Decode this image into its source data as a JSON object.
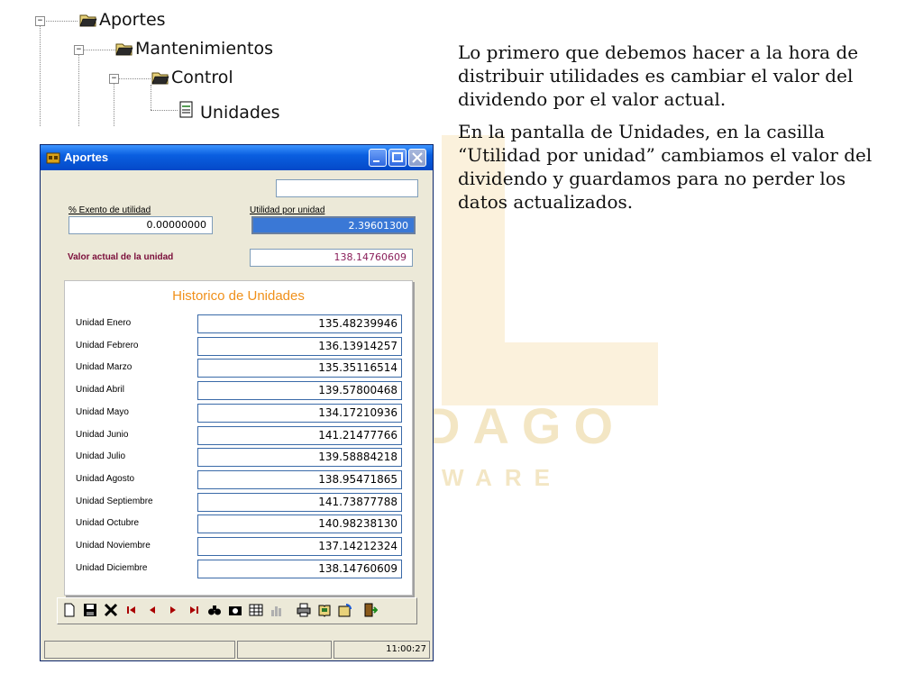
{
  "tree": {
    "nodes": [
      {
        "label": "Aportes",
        "expander": "−"
      },
      {
        "label": "Mantenimientos",
        "expander": "−"
      },
      {
        "label": "Control",
        "expander": "−"
      },
      {
        "label": "Unidades"
      }
    ]
  },
  "description": {
    "paragraph1": "Lo primero que debemos hacer a la hora de distribuir utilidades es cambiar el valor del dividendo por el valor actual.",
    "paragraph2": "En la pantalla de Unidades, en la casilla “Utilidad por unidad” cambiamos el valor del dividendo y guardamos para no perder los datos actualizados."
  },
  "watermark": {
    "line1": "DAGO",
    "line2": "WARE"
  },
  "window": {
    "title": "Aportes",
    "exento_label": "% Exento de utilidad",
    "exento_value": "0.00000000",
    "utilidad_label": "Utilidad por unidad",
    "utilidad_value": "2.39601300",
    "top_field_value": "",
    "valor_actual_label": "Valor actual de la unidad",
    "valor_actual_value": "138.14760609",
    "historico_title": "Historico de Unidades",
    "historico": [
      {
        "label": "Unidad Enero",
        "value": "135.48239946"
      },
      {
        "label": "Unidad Febrero",
        "value": "136.13914257"
      },
      {
        "label": "Unidad Marzo",
        "value": "135.35116514"
      },
      {
        "label": "Unidad Abril",
        "value": "139.57800468"
      },
      {
        "label": "Unidad Mayo",
        "value": "134.17210936"
      },
      {
        "label": "Unidad Junio",
        "value": "141.21477766"
      },
      {
        "label": "Unidad Julio",
        "value": "139.58884218"
      },
      {
        "label": "Unidad Agosto",
        "value": "138.95471865"
      },
      {
        "label": "Unidad Septiembre",
        "value": "141.73877788"
      },
      {
        "label": "Unidad Octubre",
        "value": "140.98238130"
      },
      {
        "label": "Unidad Noviembre",
        "value": "137.14212324"
      },
      {
        "label": "Unidad Diciembre",
        "value": "138.14760609"
      }
    ],
    "status_time": "11:00:27"
  },
  "toolbar": {
    "icons": [
      "new-icon",
      "save-icon",
      "delete-icon",
      "first-record-icon",
      "previous-record-icon",
      "next-record-icon",
      "last-record-icon",
      "find-icon",
      "camera-icon",
      "grid-icon",
      "chart-icon",
      "print-icon",
      "book-icon",
      "refresh-icon",
      "exit-icon"
    ]
  },
  "colors": {
    "titlebar": "#0a5fe0",
    "valor_actual_label": "#7a0d3a",
    "valor_actual_value": "#8a1f5a",
    "historico_title": "#f0901a",
    "selected_field": "#3a78d6"
  }
}
